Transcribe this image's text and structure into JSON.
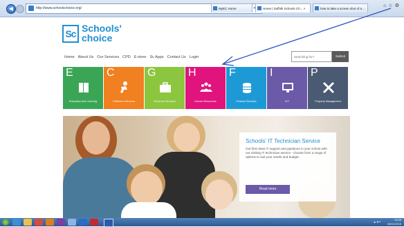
{
  "browser": {
    "url": "http://www.schoolschoice.org/",
    "address_tools": "P ▾ C",
    "tabs": [
      {
        "label": "MyEC Home"
      },
      {
        "label": "Home | Suffolk Schools Ch... ×"
      },
      {
        "label": "how to take a screen shot of a ..."
      }
    ],
    "back_icon": "back-arrow-icon",
    "forward_icon": "forward-arrow-icon"
  },
  "site": {
    "logo_mark": "Sc",
    "logo_line1": "Schools'",
    "logo_line2": "choice",
    "brand_color": "#1d8fd1"
  },
  "nav": {
    "items": [
      "Home",
      "About Us",
      "Our Services",
      "CPD",
      "E-store",
      "Sc Apps",
      "Contact Us",
      "Login"
    ]
  },
  "search": {
    "placeholder": "Searching for?",
    "button": "Submit"
  },
  "tiles": [
    {
      "letter": "E",
      "label": "Education and Learning",
      "color": "#3aa655",
      "icon": "book-icon"
    },
    {
      "letter": "C",
      "label": "Children's Services",
      "color": "#f08020",
      "icon": "person-icon"
    },
    {
      "letter": "G",
      "label": "Governor Services",
      "color": "#8cc63f",
      "icon": "briefcase-icon"
    },
    {
      "letter": "H",
      "label": "Human Resources",
      "color": "#e0147c",
      "icon": "people-icon"
    },
    {
      "letter": "F",
      "label": "Finance Services",
      "color": "#1d9ad6",
      "icon": "coins-icon"
    },
    {
      "letter": "I",
      "label": "ICT",
      "color": "#6a5aa8",
      "icon": "monitor-icon"
    },
    {
      "letter": "P",
      "label": "Property Management",
      "color": "#4a5a72",
      "icon": "tools-icon"
    }
  ],
  "hero": {
    "title": "Schools' IT Technician Service",
    "text": "Get first-class IT support and guidance in your school with our visiting IT technician service - choose from a range of options to suit your needs and budget.",
    "button": "Read more"
  },
  "taskbar": {
    "time": "10:05",
    "date": "09/01/2015"
  }
}
